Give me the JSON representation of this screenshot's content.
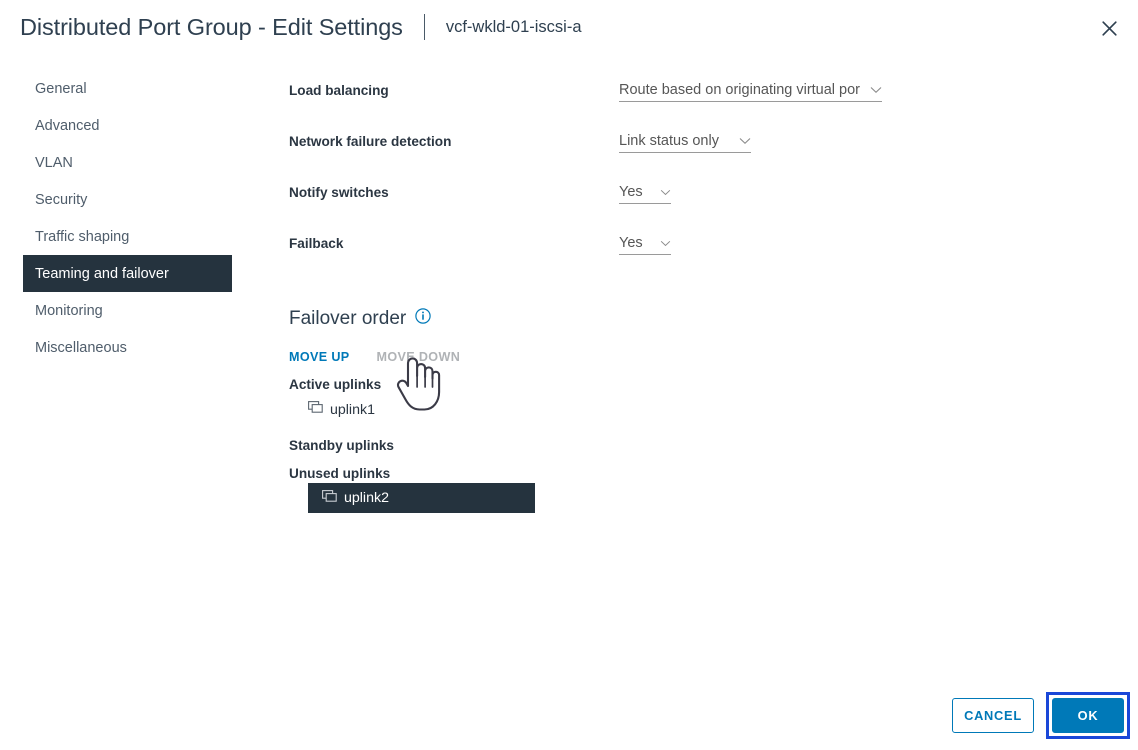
{
  "header": {
    "title": "Distributed Port Group - Edit Settings",
    "subtitle": "vcf-wkld-01-iscsi-a",
    "close_icon": "close-icon"
  },
  "sidebar": {
    "items": [
      {
        "label": "General",
        "active": false
      },
      {
        "label": "Advanced",
        "active": false
      },
      {
        "label": "VLAN",
        "active": false
      },
      {
        "label": "Security",
        "active": false
      },
      {
        "label": "Traffic shaping",
        "active": false
      },
      {
        "label": "Teaming and failover",
        "active": true
      },
      {
        "label": "Monitoring",
        "active": false
      },
      {
        "label": "Miscellaneous",
        "active": false
      }
    ]
  },
  "form": {
    "fields": [
      {
        "label": "Load balancing",
        "value": "Route based on originating virtual por",
        "icon": "chevron-down-icon"
      },
      {
        "label": "Network failure detection",
        "value": "Link status only",
        "icon": "chevron-down-icon"
      },
      {
        "label": "Notify switches",
        "value": "Yes",
        "icon": "chevron-down-icon"
      },
      {
        "label": "Failback",
        "value": "Yes",
        "icon": "chevron-down-icon"
      }
    ]
  },
  "failover": {
    "title": "Failover order",
    "info_icon": "info-icon",
    "move_up_label": "MOVE UP",
    "move_down_label": "MOVE DOWN",
    "move_down_disabled": true,
    "groups": [
      {
        "heading": "Active uplinks",
        "uplinks": [
          {
            "name": "uplink1",
            "icon": "network-adapter-icon",
            "selected": false
          }
        ]
      },
      {
        "heading": "Standby uplinks",
        "uplinks": []
      },
      {
        "heading": "Unused uplinks",
        "uplinks": [
          {
            "name": "uplink2",
            "icon": "network-adapter-icon",
            "selected": true
          }
        ]
      }
    ]
  },
  "footer": {
    "cancel_label": "CANCEL",
    "ok_label": "OK"
  },
  "cursor": {
    "type": "pointing-hand-cursor"
  },
  "colors": {
    "accent": "#0079b8",
    "selected_bg": "#25333e",
    "text": "#2b3642",
    "muted": "#b0b3b6",
    "focus_ring": "#1a47d8"
  }
}
